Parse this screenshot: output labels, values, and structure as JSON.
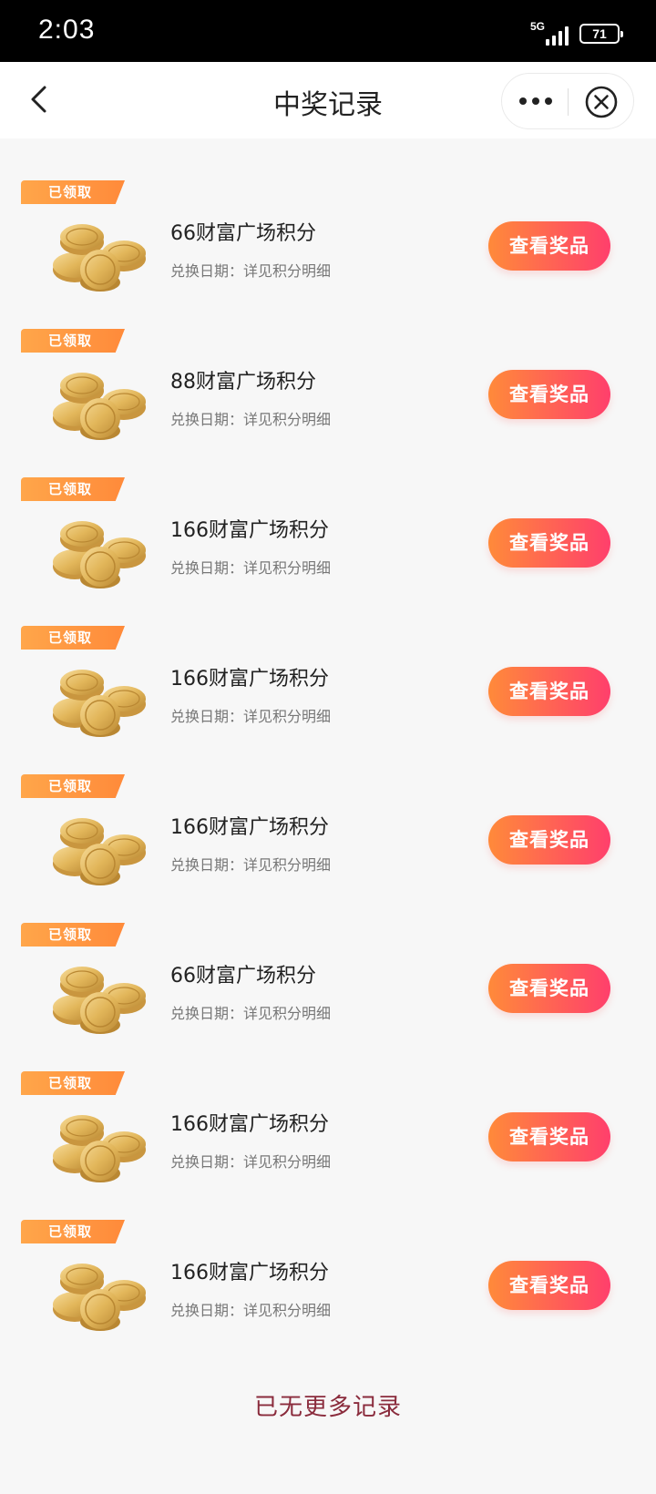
{
  "status_bar": {
    "time": "2:03",
    "network": "5G",
    "battery": "71"
  },
  "header": {
    "title": "中奖记录"
  },
  "records": [
    {
      "badge": "已领取",
      "name": "66财富广场积分",
      "date": "兑换日期：详见积分明细",
      "button": "查看奖品"
    },
    {
      "badge": "已领取",
      "name": "88财富广场积分",
      "date": "兑换日期：详见积分明细",
      "button": "查看奖品"
    },
    {
      "badge": "已领取",
      "name": "166财富广场积分",
      "date": "兑换日期：详见积分明细",
      "button": "查看奖品"
    },
    {
      "badge": "已领取",
      "name": "166财富广场积分",
      "date": "兑换日期：详见积分明细",
      "button": "查看奖品"
    },
    {
      "badge": "已领取",
      "name": "166财富广场积分",
      "date": "兑换日期：详见积分明细",
      "button": "查看奖品"
    },
    {
      "badge": "已领取",
      "name": "66财富广场积分",
      "date": "兑换日期：详见积分明细",
      "button": "查看奖品"
    },
    {
      "badge": "已领取",
      "name": "166财富广场积分",
      "date": "兑换日期：详见积分明细",
      "button": "查看奖品"
    },
    {
      "badge": "已领取",
      "name": "166财富广场积分",
      "date": "兑换日期：详见积分明细",
      "button": "查看奖品"
    }
  ],
  "footer": {
    "no_more": "已无更多记录"
  },
  "colors": {
    "accent_start": "#ff8a3a",
    "accent_end": "#ff3f6c",
    "badge": "#ffa64a",
    "footer_text": "#8a2b3c"
  },
  "icons": {
    "back": "back-chevron-icon",
    "more": "more-dots-icon",
    "close": "close-circle-icon",
    "coins": "gold-coins-icon"
  }
}
